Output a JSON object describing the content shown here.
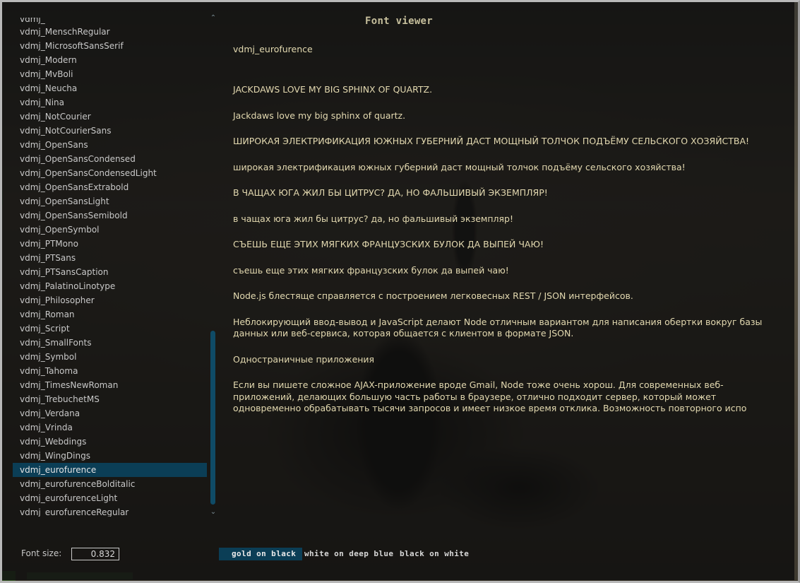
{
  "window": {
    "title": "Font viewer"
  },
  "font_list": {
    "partial_top": "vdmj_",
    "items": [
      "vdmj_MenschRegular",
      "vdmj_MicrosoftSansSerif",
      "vdmj_Modern",
      "vdmj_MvBoli",
      "vdmj_Neucha",
      "vdmj_Nina",
      "vdmj_NotCourier",
      "vdmj_NotCourierSans",
      "vdmj_OpenSans",
      "vdmj_OpenSansCondensed",
      "vdmj_OpenSansCondensedLight",
      "vdmj_OpenSansExtrabold",
      "vdmj_OpenSansLight",
      "vdmj_OpenSansSemibold",
      "vdmj_OpenSymbol",
      "vdmj_PTMono",
      "vdmj_PTSans",
      "vdmj_PTSansCaption",
      "vdmj_PalatinoLinotype",
      "vdmj_Philosopher",
      "vdmj_Roman",
      "vdmj_Script",
      "vdmj_SmallFonts",
      "vdmj_Symbol",
      "vdmj_Tahoma",
      "vdmj_TimesNewRoman",
      "vdmj_TrebuchetMS",
      "vdmj_Verdana",
      "vdmj_Vrinda",
      "vdmj_Webdings",
      "vdmj_WingDings",
      "vdmj_eurofurence",
      "vdmj_eurofurenceBolditalic",
      "vdmj_eurofurenceLight",
      "vdmj_eurofurenceRegular"
    ],
    "selected_index": 31,
    "scroll_up_icon": "chevron-up-icon",
    "scroll_down_icon": "chevron-down-icon"
  },
  "preview": {
    "font_name": "vdmj_eurofurence",
    "samples": [
      "JACKDAWS LOVE MY BIG SPHINX OF QUARTZ.",
      "Jackdaws love my big sphinx of quartz.",
      "ШИРОКАЯ ЭЛЕКТРИФИКАЦИЯ ЮЖНЫХ ГУБЕРНИЙ ДАСТ МОЩНЫЙ ТОЛЧОК ПОДЪЁМУ СЕЛЬСКОГО ХОЗЯЙСТВА!",
      "широкая электрификация южных губерний даст мощный толчок подъёму сельского хозяйства!",
      "В ЧАЩАХ ЮГА ЖИЛ БЫ ЦИТРУС? ДА, НО ФАЛЬШИВЫЙ ЭКЗЕМПЛЯР!",
      "в чащах юга жил бы цитрус? да, но фальшивый экземпляр!",
      "СЪЕШЬ ЕЩЕ ЭТИХ МЯГКИХ ФРАНЦУЗСКИХ БУЛОК ДА ВЫПЕЙ ЧАЮ!",
      "съешь еще этих мягких французских булок да выпей чаю!",
      "Node.js блестяще справляется с построением легковесных REST / JSON интерфейсов.",
      "Неблокирующий ввод-вывод и JavaScript делают Node отличным вариантом для написания обертки вокруг базы данных или веб-сервиса, которая общается с клиентом в формате JSON.",
      "Одностраничные приложения",
      "Если вы пишете сложное AJAX-приложение вроде Gmail, Node тоже очень хорош. Для современных веб-приложений, делающих большую часть работы в браузере, отлично подходит сервер, который может одновременно обрабатывать тысячи запросов и имеет низкое время отклика. Возможность повторного испо"
    ]
  },
  "font_size": {
    "label": "Font size:",
    "value": "0.832"
  },
  "color_schemes": {
    "gold_on_black": "gold on black",
    "white_on_deep_blue": "white on deep blue",
    "black_on_white": "black on white",
    "active": "gold_on_black"
  },
  "colors": {
    "selection": "#0b3e56",
    "preview_text": "#e3d9b0",
    "title_text": "#c6bf9c",
    "scroll_thumb": "#0f4b66"
  }
}
